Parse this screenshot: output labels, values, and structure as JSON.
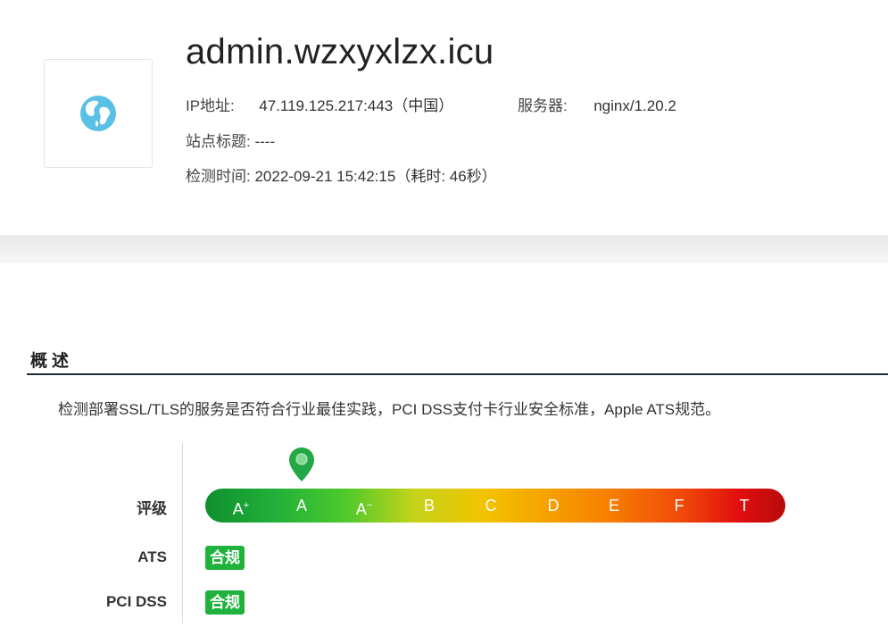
{
  "header": {
    "domain": "admin.wzxyxlzx.icu",
    "ip_label": "IP地址:",
    "ip_value": "47.119.125.217:443（中国）",
    "server_label": "服务器:",
    "server_value": "nginx/1.20.2",
    "site_title_label": "站点标题:",
    "site_title_value": "----",
    "check_time_label": "检测时间:",
    "check_time_value": "2022-09-21 15:42:15（耗时: 46秒）",
    "globe_icon": "globe-icon"
  },
  "overview": {
    "title": "概述",
    "description": "检测部署SSL/TLS的服务是否符合行业最佳实践，PCI DSS支付卡行业安全标准，Apple ATS规范。",
    "rating_label": "评级",
    "grades": [
      "A+",
      "A",
      "A-",
      "B",
      "C",
      "D",
      "E",
      "F",
      "T"
    ],
    "current_grade": "A",
    "ats_label": "ATS",
    "ats_status": "合规",
    "pci_label": "PCI DSS",
    "pci_status": "合规",
    "colors": {
      "compliant": "#1fb23d",
      "pin": "#22a845",
      "rule": "#1f2a3a"
    }
  }
}
